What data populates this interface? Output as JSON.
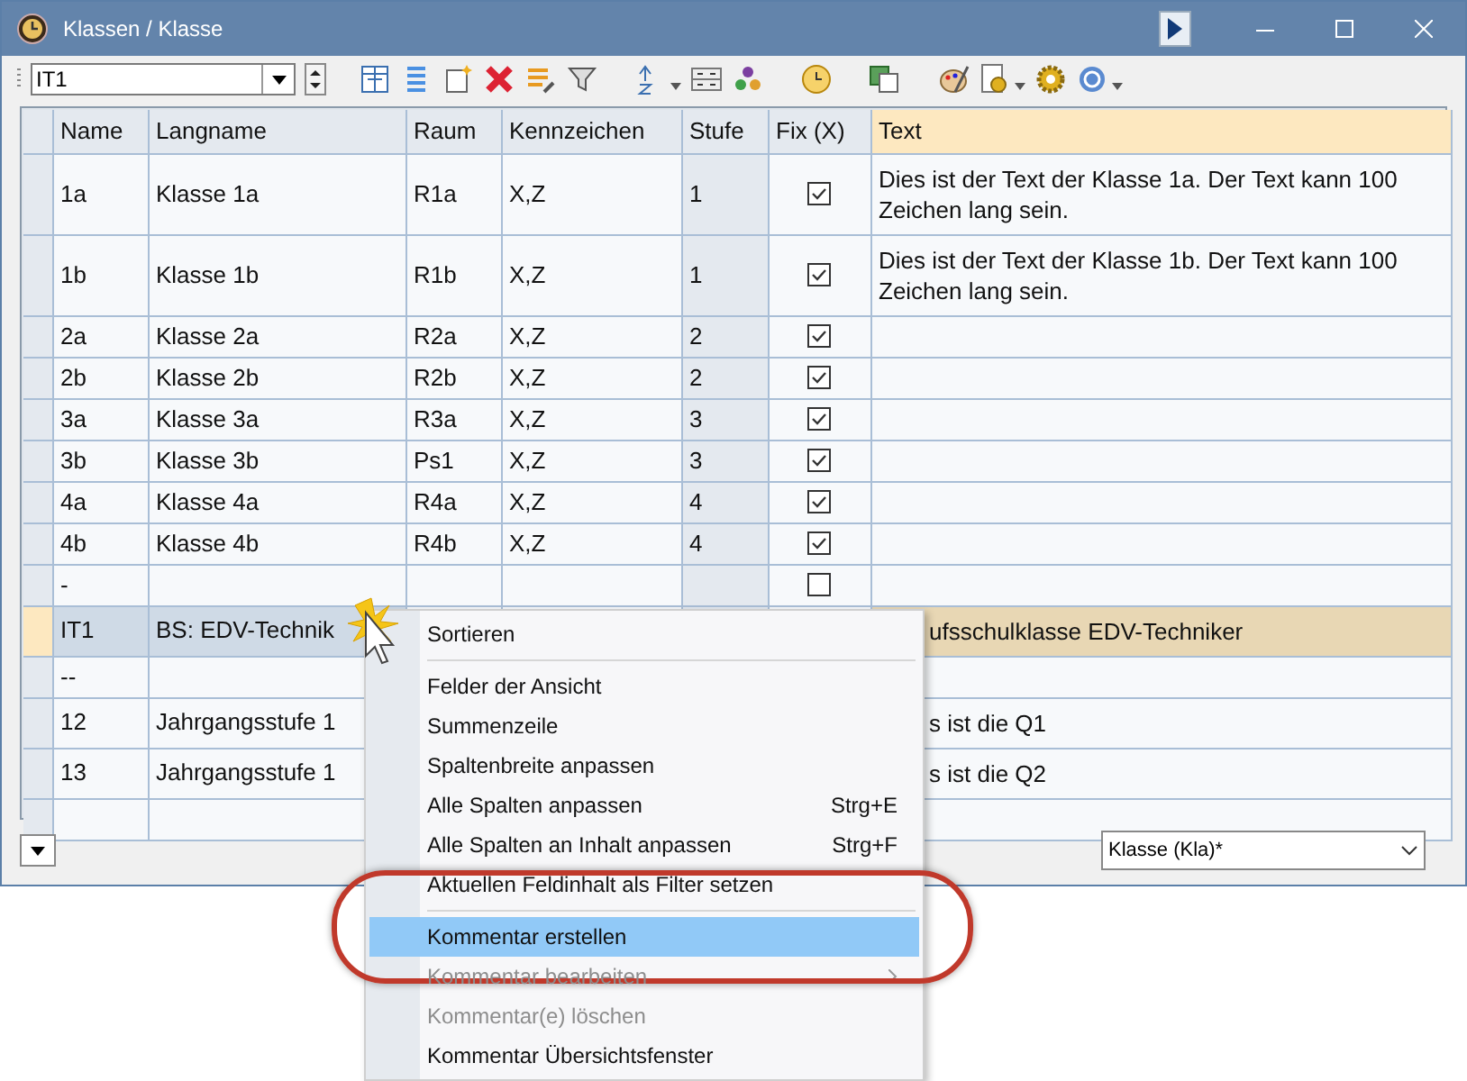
{
  "window": {
    "title": "Klassen / Klasse"
  },
  "toolbar": {
    "selector": {
      "value": "IT1"
    }
  },
  "table": {
    "columns": [
      "Name",
      "Langname",
      "Raum",
      "Kennzeichen",
      "Stufe",
      "Fix (X)",
      "Text"
    ],
    "rows": [
      {
        "kind": "full",
        "selected": false,
        "cells": [
          "1a",
          "Klasse 1a",
          "R1a",
          "X,Z",
          "1"
        ],
        "fix": true,
        "text": "Dies ist der Text der Klasse 1a. Der Text kann 100 Zeichen lang sein."
      },
      {
        "kind": "full",
        "selected": false,
        "cells": [
          "1b",
          "Klasse 1b",
          "R1b",
          "X,Z",
          "1"
        ],
        "fix": true,
        "text": "Dies ist der Text der Klasse 1b. Der Text kann 100 Zeichen lang sein."
      },
      {
        "kind": "full",
        "selected": false,
        "cells": [
          "2a",
          "Klasse 2a",
          "R2a",
          "X,Z",
          "2"
        ],
        "fix": true
      },
      {
        "kind": "full",
        "selected": false,
        "cells": [
          "2b",
          "Klasse 2b",
          "R2b",
          "X,Z",
          "2"
        ],
        "fix": true
      },
      {
        "kind": "full",
        "selected": false,
        "cells": [
          "3a",
          "Klasse 3a",
          "R3a",
          "X,Z",
          "3"
        ],
        "fix": true
      },
      {
        "kind": "full",
        "selected": false,
        "cells": [
          "3b",
          "Klasse 3b",
          "Ps1",
          "X,Z",
          "3"
        ],
        "fix": true
      },
      {
        "kind": "full",
        "selected": false,
        "cells": [
          "4a",
          "Klasse 4a",
          "R4a",
          "X,Z",
          "4"
        ],
        "fix": true
      },
      {
        "kind": "full",
        "selected": false,
        "cells": [
          "4b",
          "Klasse 4b",
          "R4b",
          "X,Z",
          "4"
        ],
        "fix": true
      },
      {
        "kind": "full",
        "selected": false,
        "cells": [
          "-"
        ],
        "fix": false
      },
      {
        "kind": "covered",
        "selected": true,
        "cells": [
          "IT1",
          "BS: EDV-Technik"
        ],
        "text": "ufsschulklasse EDV-Techniker"
      },
      {
        "kind": "covered",
        "selected": false,
        "cells": [
          "--"
        ]
      },
      {
        "kind": "covered",
        "selected": false,
        "cells": [
          "12",
          "Jahrgangsstufe 1"
        ],
        "text": "s ist die Q1"
      },
      {
        "kind": "covered",
        "selected": false,
        "cells": [
          "13",
          "Jahrgangsstufe 1"
        ],
        "text": "s ist die Q2"
      },
      {
        "kind": "full",
        "selected": false,
        "cells": []
      }
    ]
  },
  "view_selector": {
    "value": "Klasse (Kla)*"
  },
  "context_menu": {
    "items": [
      {
        "kind": "item",
        "label": "Sortieren",
        "selected": false,
        "disabled": false
      },
      {
        "kind": "separator"
      },
      {
        "kind": "item",
        "label": "Felder der Ansicht",
        "selected": false,
        "disabled": false
      },
      {
        "kind": "item",
        "label": "Summenzeile",
        "selected": false,
        "disabled": false
      },
      {
        "kind": "item",
        "label": "Spaltenbreite anpassen",
        "selected": false,
        "disabled": false
      },
      {
        "kind": "item",
        "label": "Alle Spalten anpassen",
        "shortcut": "Strg+E",
        "selected": false,
        "disabled": false
      },
      {
        "kind": "item",
        "label": "Alle Spalten an Inhalt anpassen",
        "shortcut": "Strg+F",
        "selected": false,
        "disabled": false
      },
      {
        "kind": "item",
        "label": "Aktuellen Feldinhalt als Filter setzen",
        "selected": false,
        "disabled": false
      },
      {
        "kind": "separator"
      },
      {
        "kind": "item",
        "label": "Kommentar erstellen",
        "selected": true,
        "disabled": false
      },
      {
        "kind": "item",
        "label": "Kommentar bearbeiten",
        "selected": false,
        "disabled": true,
        "submenu": true
      },
      {
        "kind": "item",
        "label": "Kommentar(e) löschen",
        "selected": false,
        "disabled": true
      },
      {
        "kind": "item",
        "label": "Kommentar Übersichtsfenster",
        "selected": false,
        "disabled": false
      }
    ]
  }
}
